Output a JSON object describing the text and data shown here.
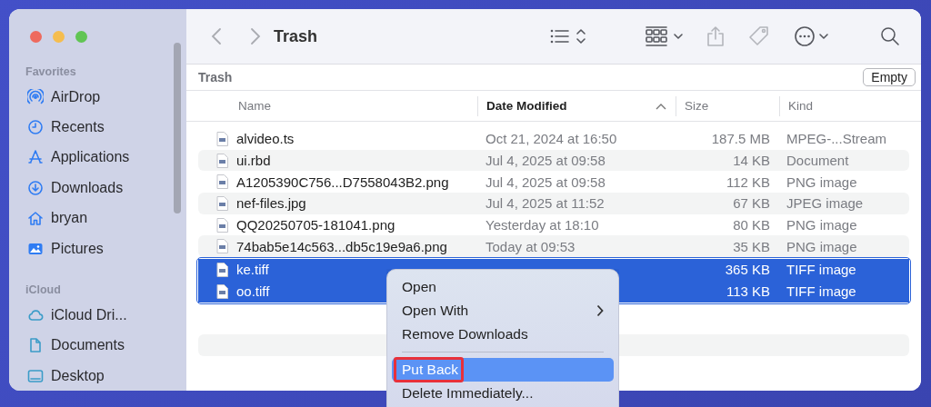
{
  "window": {
    "title": "Trash",
    "path_label": "Trash",
    "empty_button": "Empty"
  },
  "sidebar": {
    "sections": [
      {
        "title": "Favorites",
        "items": [
          {
            "label": "AirDrop",
            "selected": false
          },
          {
            "label": "Recents",
            "selected": false
          },
          {
            "label": "Applications",
            "selected": false
          },
          {
            "label": "Downloads",
            "selected": false
          },
          {
            "label": "bryan",
            "selected": false
          },
          {
            "label": "Pictures",
            "selected": false
          }
        ]
      },
      {
        "title": "iCloud",
        "items": [
          {
            "label": "iCloud Dri...",
            "selected": false
          },
          {
            "label": "Documents",
            "selected": false
          },
          {
            "label": "Desktop",
            "selected": false
          }
        ]
      }
    ]
  },
  "table": {
    "columns": [
      {
        "label": "Name",
        "sorted": false
      },
      {
        "label": "Date Modified",
        "sorted": true
      },
      {
        "label": "Size",
        "sorted": false
      },
      {
        "label": "Kind",
        "sorted": false
      }
    ],
    "rows": [
      {
        "name": "alvideo.ts",
        "date": "Oct 21, 2024 at 16:50",
        "size": "187.5 MB",
        "kind": "MPEG-...Stream",
        "selected": false
      },
      {
        "name": "ui.rbd",
        "date": "Jul 4, 2025 at 09:58",
        "size": "14 KB",
        "kind": "Document",
        "selected": false
      },
      {
        "name": "A1205390C756...D7558043B2.png",
        "date": "Jul 4, 2025 at 09:58",
        "size": "112 KB",
        "kind": "PNG image",
        "selected": false
      },
      {
        "name": "nef-files.jpg",
        "date": "Jul 4, 2025 at 11:52",
        "size": "67 KB",
        "kind": "JPEG image",
        "selected": false
      },
      {
        "name": "QQ20250705-181041.png",
        "date": "Yesterday at 18:10",
        "size": "80 KB",
        "kind": "PNG image",
        "selected": false
      },
      {
        "name": "74bab5e14c563...db5c19e9a6.png",
        "date": "Today at 09:53",
        "size": "35 KB",
        "kind": "PNG image",
        "selected": false
      },
      {
        "name": "ke.tiff",
        "size": "365 KB",
        "kind": "TIFF image",
        "selected": true
      },
      {
        "name": "oo.tiff",
        "size": "113 KB",
        "kind": "TIFF image",
        "selected": true
      }
    ]
  },
  "context_menu": {
    "items": [
      {
        "kind": "item",
        "label": "Open",
        "highlighted": false,
        "submenu": false
      },
      {
        "kind": "item",
        "label": "Open With",
        "highlighted": false,
        "submenu": true
      },
      {
        "kind": "item",
        "label": "Remove Downloads",
        "highlighted": false,
        "submenu": false
      },
      {
        "kind": "separator"
      },
      {
        "kind": "item",
        "label": "Put Back",
        "highlighted": true,
        "submenu": false,
        "annotated": true
      },
      {
        "kind": "item",
        "label": "Delete Immediately...",
        "highlighted": false,
        "submenu": false
      }
    ]
  }
}
